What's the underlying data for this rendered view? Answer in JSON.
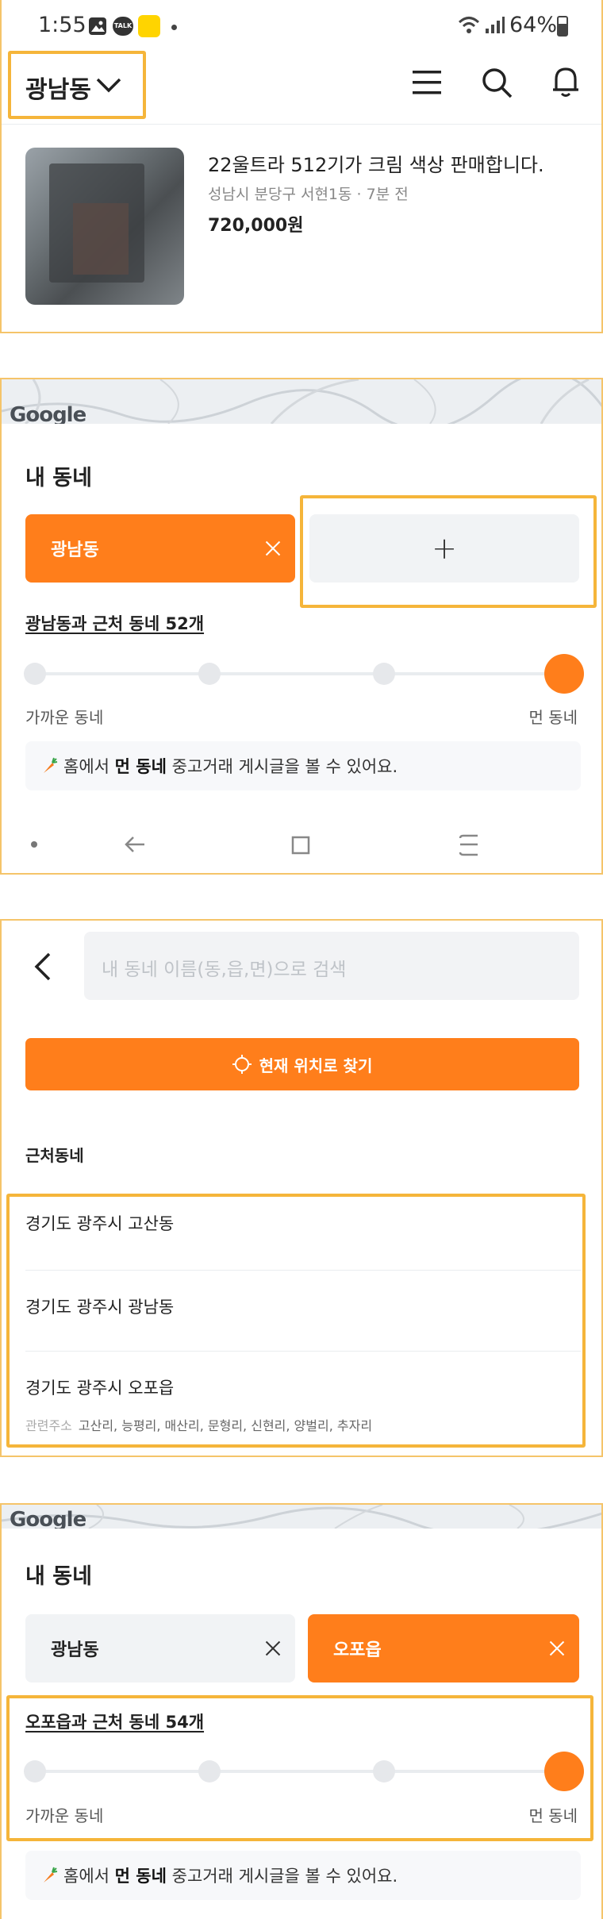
{
  "status_bar": {
    "time": "1:55",
    "talk_badge": "TALK",
    "battery": "64%"
  },
  "home_header": {
    "location": "광남동"
  },
  "listing": {
    "title": "22울트라 512기가 크림 색상 판매합니다.",
    "meta": "성남시 분당구 서현1동 · 7분 전",
    "price": "720,000원"
  },
  "map_logo": "Google",
  "my_neighborhood_1": {
    "title": "내 동네",
    "chip_selected": "광남동",
    "add_symbol": "+",
    "range_label": "광남동과 근처 동네 52개",
    "range_level": 1.0,
    "near_label": "가까운 동네",
    "far_label": "먼 동네",
    "tip_prefix": "홈에서",
    "tip_bold": "먼 동네",
    "tip_suffix": "중고거래 게시글을 볼 수 있어요."
  },
  "search_screen": {
    "search_placeholder": "내 동네 이름(동,읍,면)으로 검색",
    "locate_button": "현재 위치로 찾기",
    "nearby_header": "근처동네",
    "results": [
      {
        "name": "경기도 광주시 고산동"
      },
      {
        "name": "경기도 광주시 광남동"
      },
      {
        "name": "경기도 광주시 오포읍"
      }
    ],
    "related_label": "관련주소",
    "related_value": "고산리, 능평리, 매산리, 문형리, 신현리, 양벌리, 추자리"
  },
  "my_neighborhood_2": {
    "title": "내 동네",
    "chip_1": "광남동",
    "chip_2": "오포읍",
    "range_label": "오포읍과 근처 동네 54개",
    "range_level": 1.0,
    "near_label": "가까운 동네",
    "far_label": "먼 동네",
    "tip_prefix": "홈에서",
    "tip_bold": "먼 동네",
    "tip_suffix": "중고거래 게시글을 볼 수 있어요."
  },
  "colors": {
    "accent": "#ff7e1b",
    "highlight": "#f5b53a",
    "chip_gray": "#f1f3f5"
  }
}
